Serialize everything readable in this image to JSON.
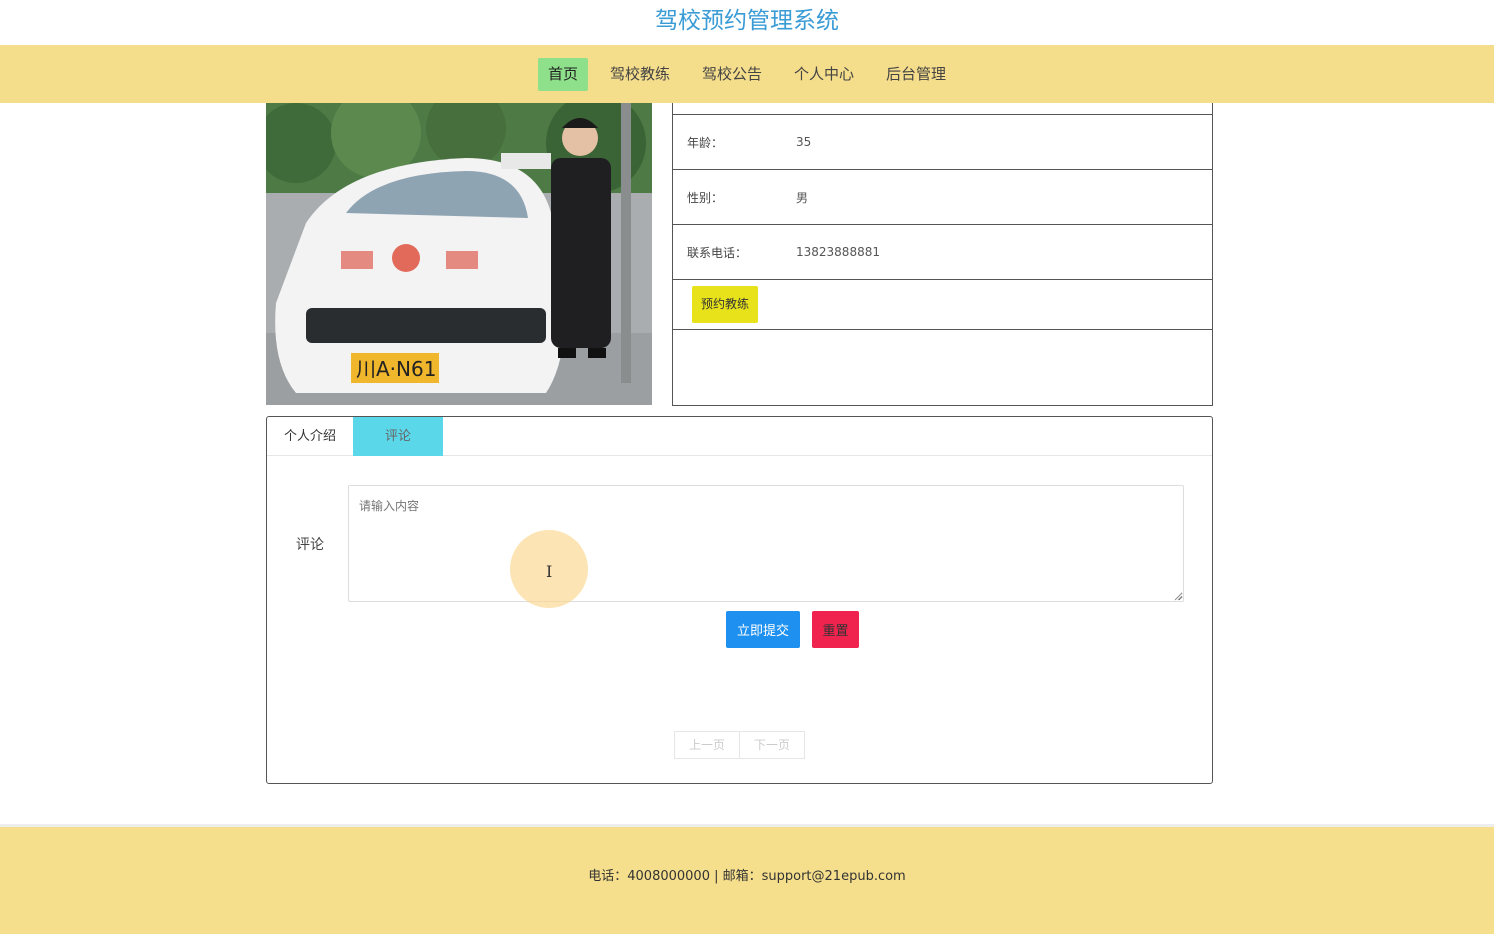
{
  "header": {
    "title": "驾校预约管理系统"
  },
  "nav": {
    "items": [
      {
        "label": "首页",
        "active": true
      },
      {
        "label": "驾校教练",
        "active": false
      },
      {
        "label": "驾校公告",
        "active": false
      },
      {
        "label": "个人中心",
        "active": false
      },
      {
        "label": "后台管理",
        "active": false
      }
    ]
  },
  "coach": {
    "photo_alt": "coach-photo",
    "fields": [
      {
        "label": "年龄：",
        "value": "35"
      },
      {
        "label": "性别：",
        "value": "男"
      },
      {
        "label": "联系电话：",
        "value": "13823888881"
      }
    ],
    "book_label": "预约教练"
  },
  "tabs": {
    "items": [
      {
        "label": "个人介绍",
        "active": false
      },
      {
        "label": "评论",
        "active": true
      }
    ]
  },
  "comment_form": {
    "label": "评论",
    "placeholder": "请输入内容",
    "submit_label": "立即提交",
    "reset_label": "重置"
  },
  "pagination": {
    "prev_label": "上一页",
    "next_label": "下一页"
  },
  "footer": {
    "text": "电话：4008000000 | 邮箱：support@21epub.com"
  },
  "colors": {
    "brand_title": "#3a9bd5",
    "nav_bg": "#f4dd8b",
    "nav_active": "#8ee08a",
    "book_button": "#e8e21a",
    "tab_active": "#5ad8ea",
    "submit_button": "#1e90ef",
    "reset_button": "#f0234f"
  }
}
